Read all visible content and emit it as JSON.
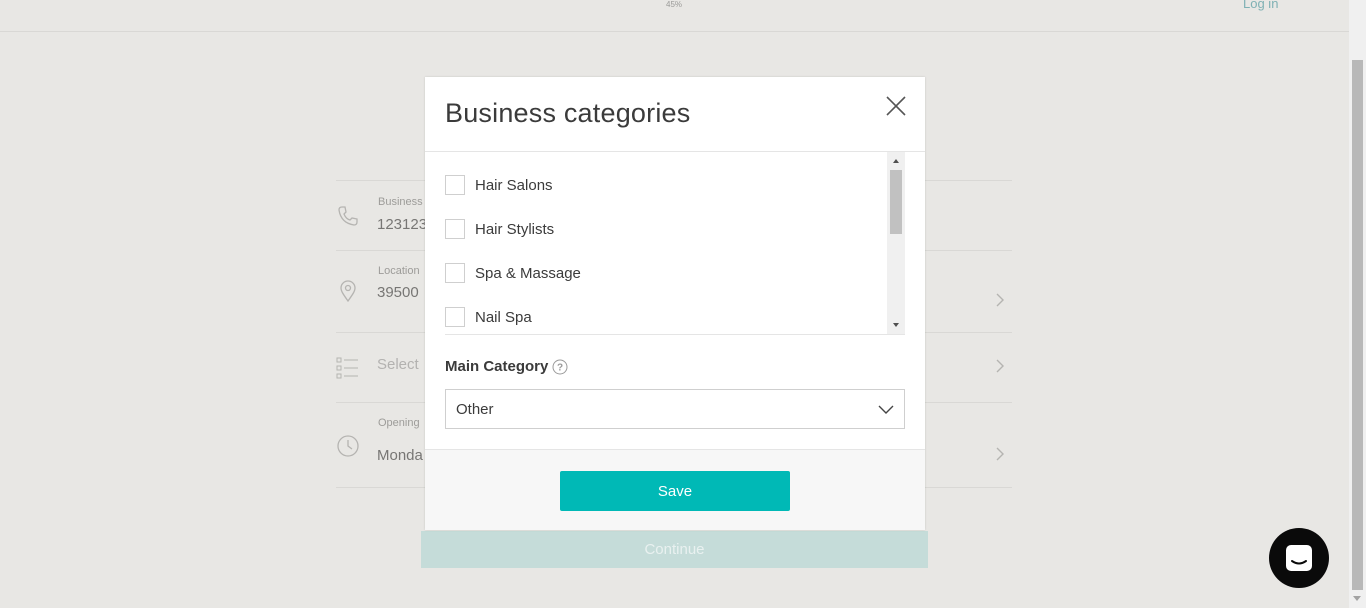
{
  "header": {
    "progress_text": "45%",
    "login_label": "Log in"
  },
  "background_form": {
    "phone_label": "Business",
    "phone_value": "123123",
    "location_label": "Location",
    "location_value": "39500",
    "category_placeholder": "Select",
    "hours_label": "Opening",
    "hours_value": "Monda",
    "continue_label": "Continue"
  },
  "modal": {
    "title": "Business categories",
    "categories": [
      {
        "label": "Hair Salons",
        "checked": false
      },
      {
        "label": "Hair Stylists",
        "checked": false
      },
      {
        "label": "Spa & Massage",
        "checked": false
      },
      {
        "label": "Nail Spa",
        "checked": false
      }
    ],
    "main_category_label": "Main Category",
    "main_category_value": "Other",
    "save_label": "Save"
  },
  "colors": {
    "accent": "#00b9b6",
    "overlay_bg": "#e8e7e4",
    "chat_launcher": "#0a0a0a"
  },
  "icons": [
    "phone-icon",
    "location-pin-icon",
    "list-icon",
    "clock-icon",
    "chevron-right-icon",
    "close-icon",
    "help-icon",
    "chevron-down-icon",
    "chat-icon"
  ]
}
